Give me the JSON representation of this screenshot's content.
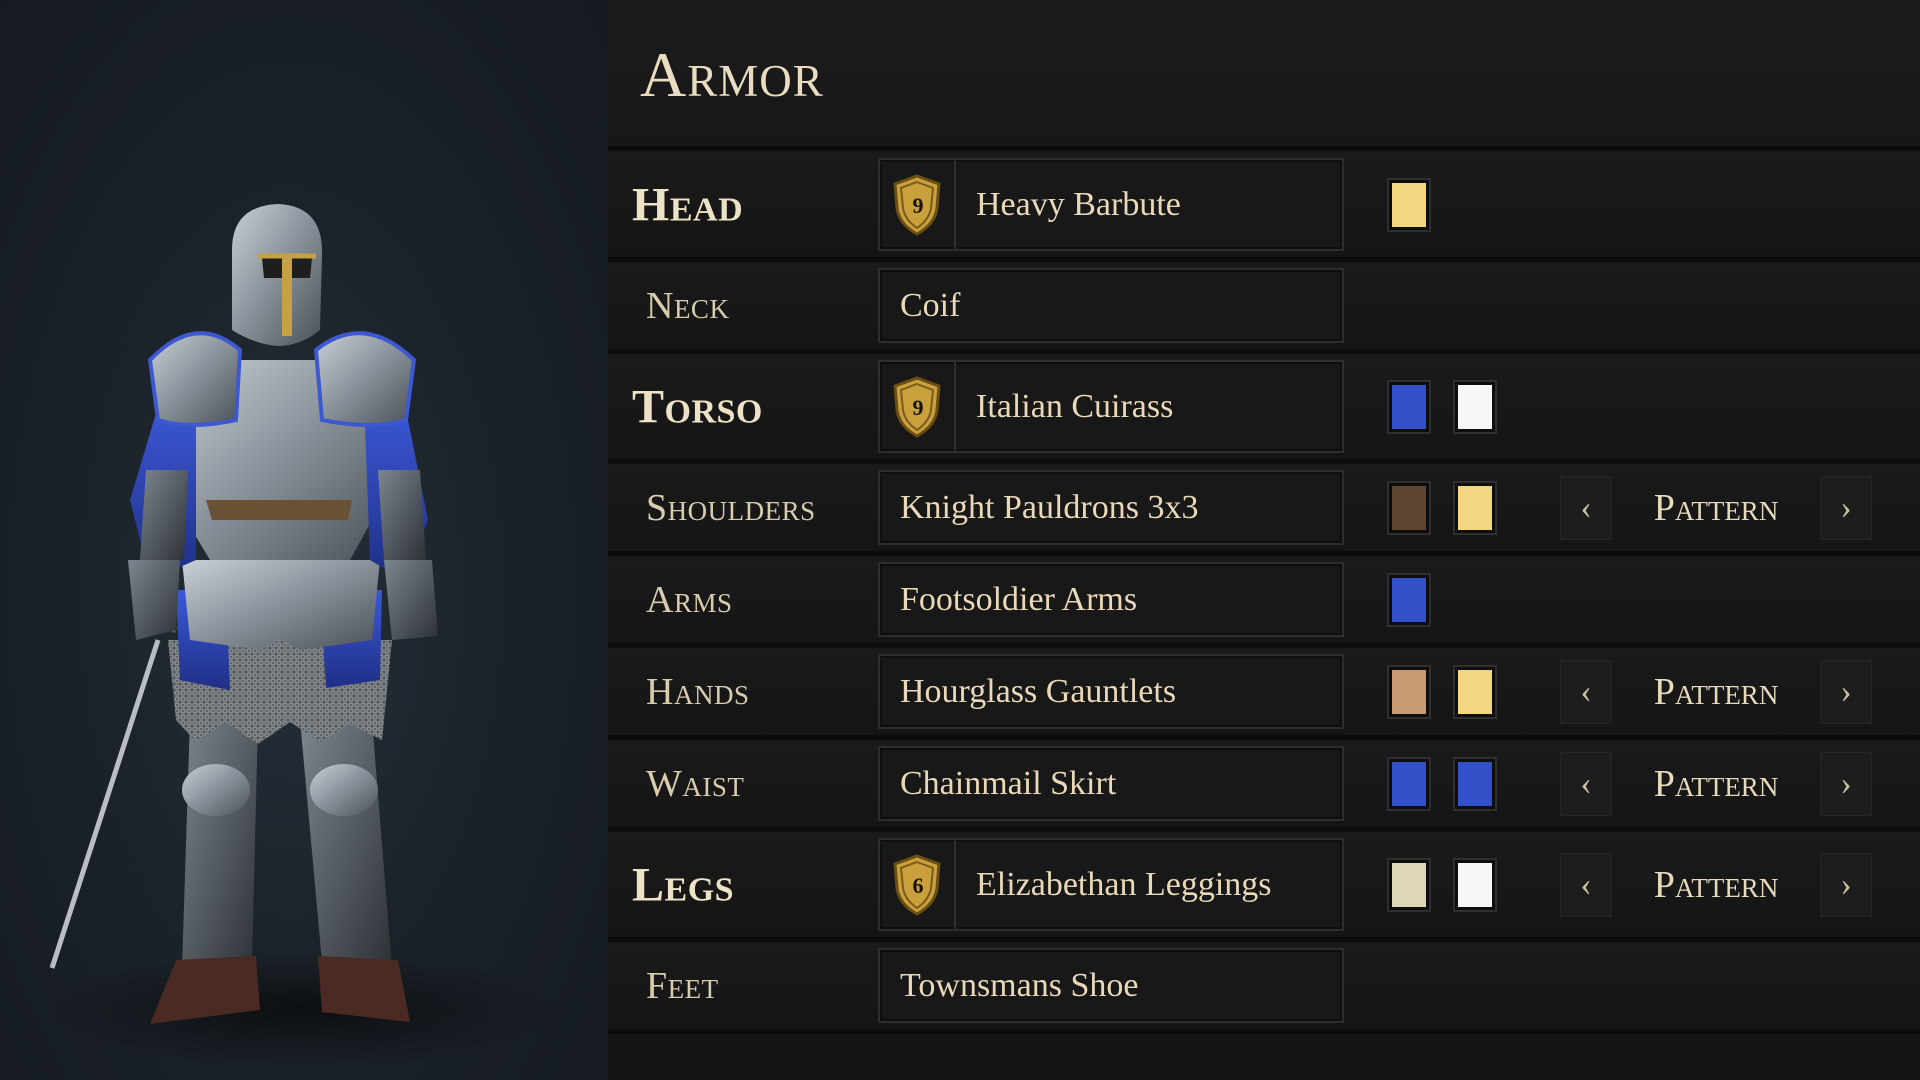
{
  "panel": {
    "title": "Armor"
  },
  "slots": [
    {
      "label": "Head",
      "item": "Heavy Barbute",
      "tier": "9",
      "colors": [
        "#f2d680"
      ],
      "pattern": null
    },
    {
      "label": "Neck",
      "item": "Coif",
      "tier": null,
      "colors": [],
      "pattern": null
    },
    {
      "label": "Torso",
      "item": "Italian Cuirass",
      "tier": "9",
      "colors": [
        "#3350c8",
        "#f6f6f6"
      ],
      "pattern": null
    },
    {
      "label": "Shoulders",
      "item": "Knight Pauldrons 3x3",
      "tier": null,
      "colors": [
        "#5e4630",
        "#f2d680"
      ],
      "pattern": {
        "label": "Pattern",
        "prev": "‹",
        "next": "›"
      }
    },
    {
      "label": "Arms",
      "item": "Footsoldier Arms",
      "tier": null,
      "colors": [
        "#3350c8"
      ],
      "pattern": null
    },
    {
      "label": "Hands",
      "item": "Hourglass Gauntlets",
      "tier": null,
      "colors": [
        "#c89a72",
        "#f2d680"
      ],
      "pattern": {
        "label": "Pattern",
        "prev": "‹",
        "next": "›"
      }
    },
    {
      "label": "Waist",
      "item": "Chainmail Skirt",
      "tier": null,
      "colors": [
        "#3350c8",
        "#3350c8"
      ],
      "pattern": {
        "label": "Pattern",
        "prev": "‹",
        "next": "›"
      }
    },
    {
      "label": "Legs",
      "item": "Elizabethan Leggings",
      "tier": "6",
      "colors": [
        "#ddd6b8",
        "#f6f6f6"
      ],
      "pattern": {
        "label": "Pattern",
        "prev": "‹",
        "next": "›"
      }
    },
    {
      "label": "Feet",
      "item": "Townsmans Shoe",
      "tier": null,
      "colors": [],
      "pattern": null
    }
  ],
  "theme": {
    "accent": "#e8dcc0",
    "badge_gold": "#c9a03c"
  }
}
